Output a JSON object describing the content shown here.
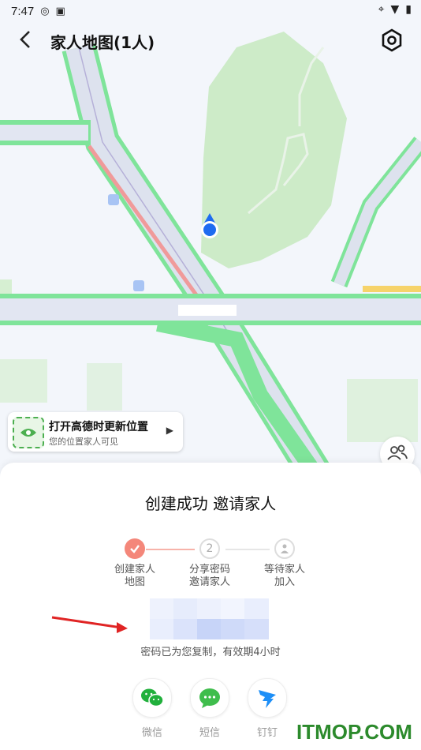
{
  "status": {
    "time": "7:47"
  },
  "header": {
    "title": "家人地图(1人)"
  },
  "banner": {
    "title": "打开高德时更新位置",
    "subtitle": "您的位置家人可见"
  },
  "sheet": {
    "title": "创建成功 邀请家人",
    "steps": [
      {
        "number": "",
        "line1": "创建家人",
        "line2": "地图"
      },
      {
        "number": "2",
        "line1": "分享密码",
        "line2": "邀请家人"
      },
      {
        "number": "",
        "line1": "等待家人",
        "line2": "加入"
      }
    ],
    "copied_text": "密码已为您复制，有效期4小时",
    "share": [
      {
        "label": "微信"
      },
      {
        "label": "短信"
      },
      {
        "label": "钉钉"
      }
    ]
  },
  "colors": {
    "accent_done": "#f4877a",
    "map_green": "#7fe49a",
    "blue": "#1e6cf0"
  },
  "watermark": "ITMOP.COM"
}
